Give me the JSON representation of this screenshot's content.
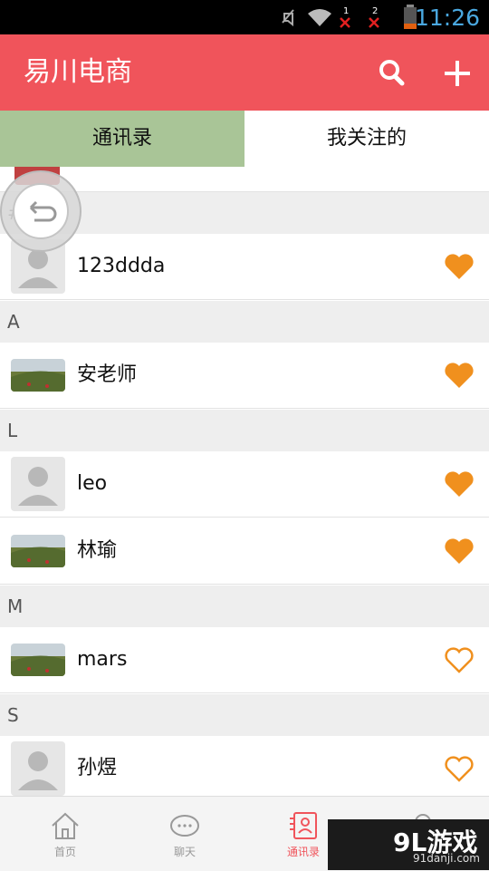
{
  "status_bar": {
    "time": "11:26",
    "sim1": "1",
    "sim2": "2"
  },
  "app_bar": {
    "title": "易川电商"
  },
  "tabs": [
    {
      "label": "通讯录",
      "active": true
    },
    {
      "label": "我关注的",
      "active": false
    }
  ],
  "contacts": [
    {
      "section": "#",
      "name": "123ddda",
      "avatar": "default-avatar",
      "followed": true
    },
    {
      "section": "A",
      "name": "安老师",
      "avatar": "photo-avatar",
      "followed": true
    },
    {
      "section": "L",
      "name": "leo",
      "avatar": "default-avatar",
      "followed": true
    },
    {
      "section": "L",
      "name": "林瑜",
      "avatar": "photo-avatar",
      "followed": true
    },
    {
      "section": "M",
      "name": "mars",
      "avatar": "photo-avatar",
      "followed": false
    },
    {
      "section": "S",
      "name": "孙煜",
      "avatar": "default-avatar",
      "followed": false
    }
  ],
  "sections": [
    "#",
    "A",
    "L",
    "M",
    "S"
  ],
  "bottom_nav": [
    {
      "label": "首页",
      "icon": "home-icon",
      "active": false
    },
    {
      "label": "聊天",
      "icon": "chat-icon",
      "active": false
    },
    {
      "label": "通讯录",
      "icon": "contacts-icon",
      "active": true
    },
    {
      "label": "",
      "icon": "discover-icon",
      "active": false
    }
  ],
  "colors": {
    "accent": "#f0545b",
    "tab_active": "#a9c597",
    "heart": "#f0901e"
  },
  "watermark": {
    "logo": "9L游戏",
    "url": "91danji.com"
  }
}
